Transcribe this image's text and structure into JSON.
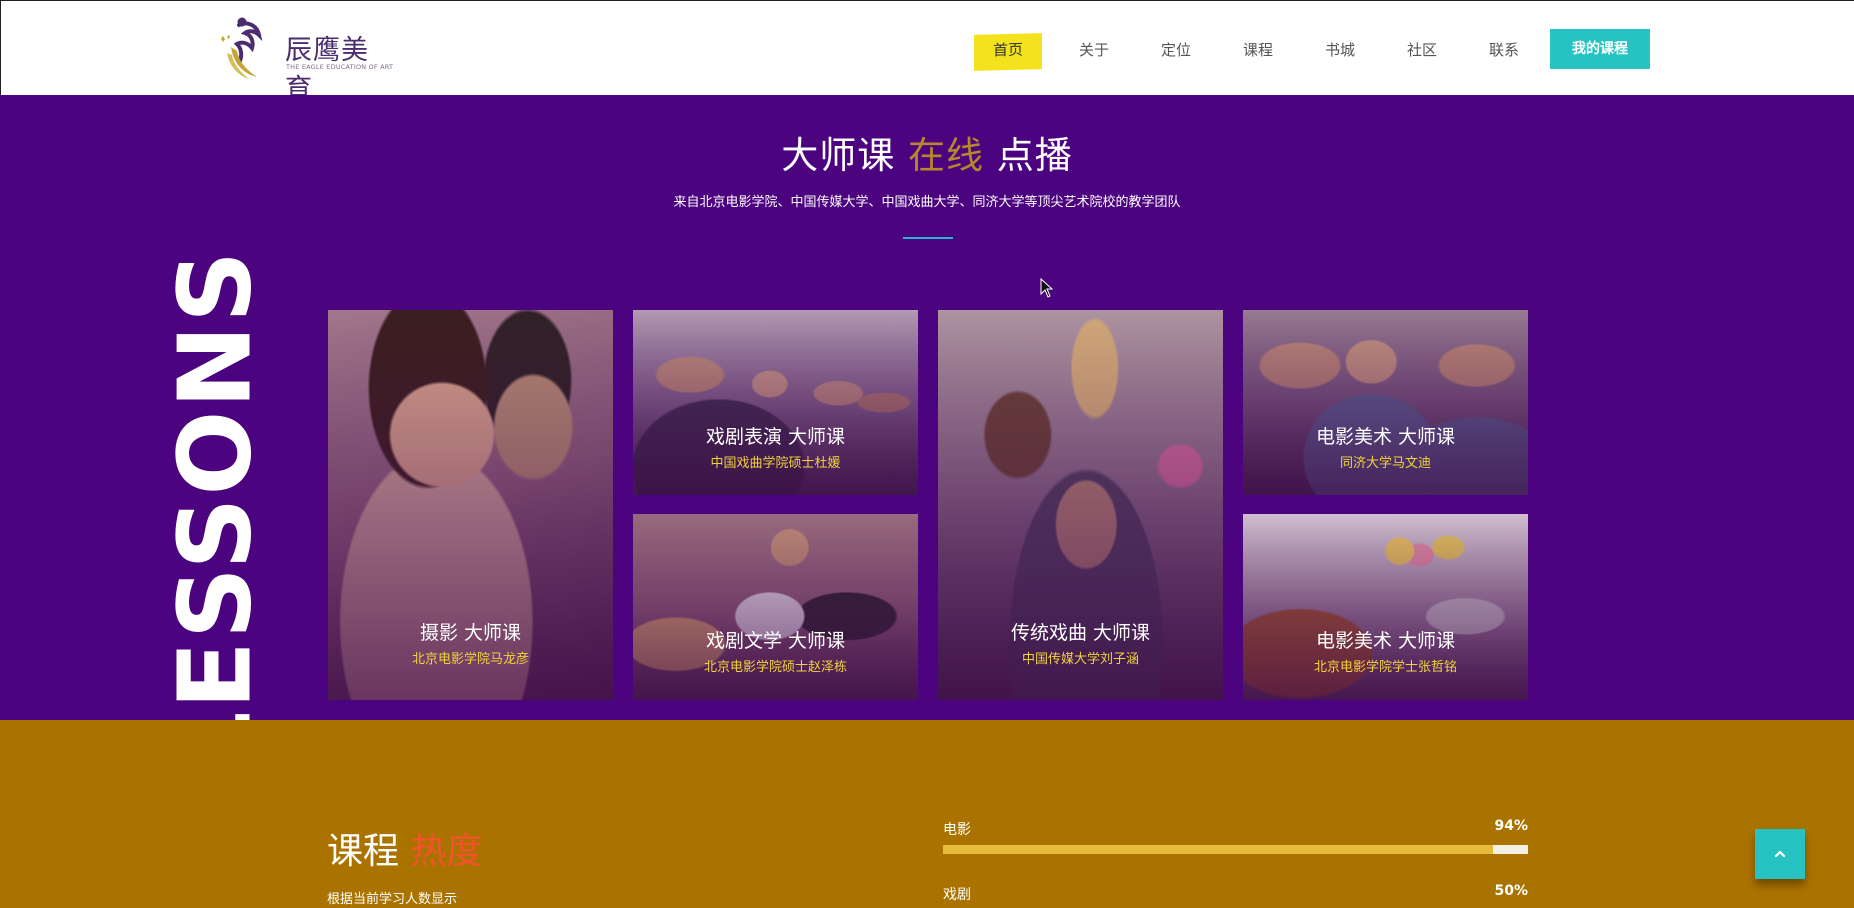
{
  "header": {
    "logo": {
      "name": "辰鹰美育",
      "tagline": "THE EAGLE EDUCATION OF ART"
    },
    "nav": [
      {
        "label": "首页",
        "active": true
      },
      {
        "label": "关于"
      },
      {
        "label": "定位"
      },
      {
        "label": "课程"
      },
      {
        "label": "书城"
      },
      {
        "label": "社区"
      },
      {
        "label": "联系"
      }
    ],
    "my_course": "我的课程"
  },
  "masterclass": {
    "title_part1": "大师课",
    "title_accent": "在线",
    "title_part2": "点播",
    "subtitle": "来自北京电影学院、中国传媒大学、中国戏曲大学、同济大学等顶尖艺术院校的教学团队",
    "vertical_word": "LESSONS",
    "cards": [
      {
        "title": "摄影 大师课",
        "teacher": "北京电影学院马龙彦"
      },
      {
        "title": "戏剧表演 大师课",
        "teacher": "中国戏曲学院硕士杜媛"
      },
      {
        "title": "戏剧文学 大师课",
        "teacher": "北京电影学院硕士赵泽栋"
      },
      {
        "title": "传统戏曲 大师课",
        "teacher": "中国传媒大学刘子涵"
      },
      {
        "title": "电影美术 大师课",
        "teacher": "同济大学马文迪"
      },
      {
        "title": "电影美术 大师课",
        "teacher": "北京电影学院学士张哲铭"
      }
    ]
  },
  "popularity": {
    "title_part1": "课程",
    "title_accent": "热度",
    "subtitle": "根据当前学习人数显示",
    "bars": [
      {
        "label": "电影",
        "percent_text": "94%",
        "fraction": 0.94
      },
      {
        "label": "戏剧",
        "percent_text": "50%",
        "fraction": 0.5
      }
    ]
  },
  "colors": {
    "header_bg": "#ffffff",
    "nav_active_bg": "#f4e21d",
    "button_teal": "#27c3c3",
    "section_purple": "#4b0380",
    "title_accent_gold": "#b8872b",
    "section_gold": "#aa7300",
    "bar_fill": "#e7bc3c",
    "popularity_accent": "#f0542b",
    "card_caption": "#f2d33c"
  },
  "icons": {
    "back_to_top": "chevron-up-icon",
    "cursor": "mouse-pointer-icon"
  }
}
